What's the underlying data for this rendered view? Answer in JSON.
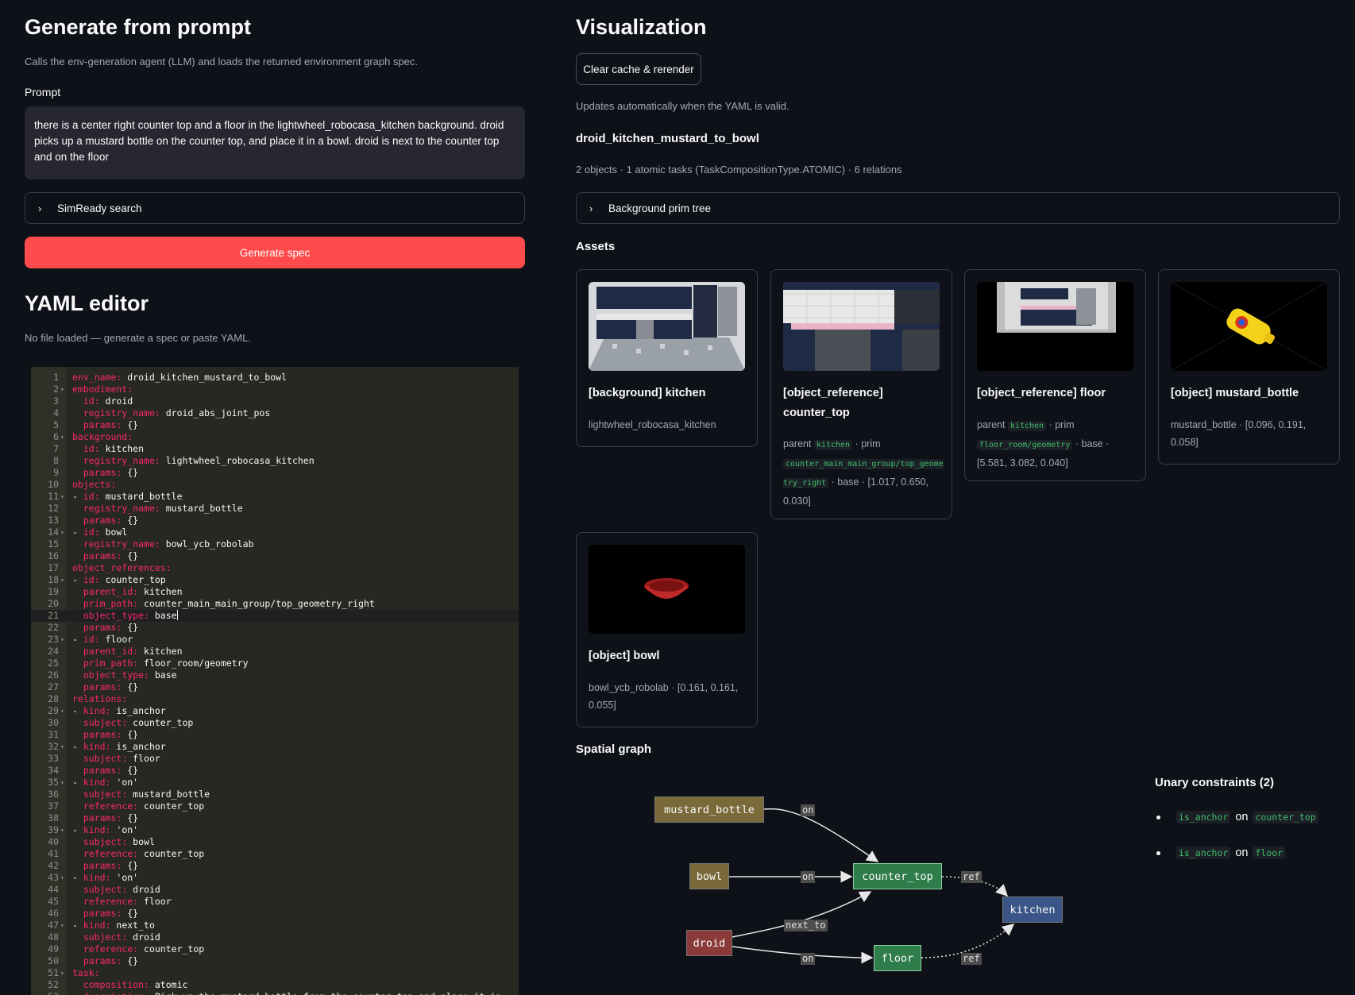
{
  "left": {
    "generate": {
      "heading": "Generate from prompt",
      "caption": "Calls the env-generation agent (LLM) and loads the returned environment graph spec.",
      "prompt_label": "Prompt",
      "prompt_value": "there is a center right counter top and a floor in the lightwheel_robocasa_kitchen background. droid picks up a mustard bottle on the counter top, and place it in a bowl. droid is next to the counter top and on the floor",
      "simready_label": "SimReady search",
      "generate_button": "Generate spec"
    },
    "yaml": {
      "heading": "YAML editor",
      "caption": "No file loaded — generate a spec or paste YAML.",
      "lines": [
        {
          "n": "1",
          "fold": "",
          "key": "env_name:",
          "val": " droid_kitchen_mustard_to_bowl",
          "indent": ""
        },
        {
          "n": "2",
          "fold": "▾",
          "key": "embodiment:",
          "val": "",
          "indent": ""
        },
        {
          "n": "3",
          "fold": "",
          "key": "id:",
          "val": " droid",
          "indent": "  "
        },
        {
          "n": "4",
          "fold": "",
          "key": "registry_name:",
          "val": " droid_abs_joint_pos",
          "indent": "  "
        },
        {
          "n": "5",
          "fold": "",
          "key": "params:",
          "val": " {}",
          "indent": "  "
        },
        {
          "n": "6",
          "fold": "▾",
          "key": "background:",
          "val": "",
          "indent": ""
        },
        {
          "n": "7",
          "fold": "",
          "key": "id:",
          "val": " kitchen",
          "indent": "  "
        },
        {
          "n": "8",
          "fold": "",
          "key": "registry_name:",
          "val": " lightwheel_robocasa_kitchen",
          "indent": "  "
        },
        {
          "n": "9",
          "fold": "",
          "key": "params:",
          "val": " {}",
          "indent": "  "
        },
        {
          "n": "10",
          "fold": "",
          "key": "objects:",
          "val": "",
          "indent": ""
        },
        {
          "n": "11",
          "fold": "▾",
          "key": "id:",
          "val": " mustard_bottle",
          "indent": "- "
        },
        {
          "n": "12",
          "fold": "",
          "key": "registry_name:",
          "val": " mustard_bottle",
          "indent": "  "
        },
        {
          "n": "13",
          "fold": "",
          "key": "params:",
          "val": " {}",
          "indent": "  "
        },
        {
          "n": "14",
          "fold": "▾",
          "key": "id:",
          "val": " bowl",
          "indent": "- "
        },
        {
          "n": "15",
          "fold": "",
          "key": "registry_name:",
          "val": " bowl_ycb_robolab",
          "indent": "  "
        },
        {
          "n": "16",
          "fold": "",
          "key": "params:",
          "val": " {}",
          "indent": "  "
        },
        {
          "n": "17",
          "fold": "",
          "key": "object_references:",
          "val": "",
          "indent": ""
        },
        {
          "n": "18",
          "fold": "▾",
          "key": "id:",
          "val": " counter_top",
          "indent": "- "
        },
        {
          "n": "19",
          "fold": "",
          "key": "parent_id:",
          "val": " kitchen",
          "indent": "  "
        },
        {
          "n": "20",
          "fold": "",
          "key": "prim_path:",
          "val": " counter_main_main_group/top_geometry_right",
          "indent": "  "
        },
        {
          "n": "21",
          "fold": "",
          "key": "object_type:",
          "val": " base",
          "indent": "  "
        },
        {
          "n": "22",
          "fold": "",
          "key": "params:",
          "val": " {}",
          "indent": "  "
        },
        {
          "n": "23",
          "fold": "▾",
          "key": "id:",
          "val": " floor",
          "indent": "- "
        },
        {
          "n": "24",
          "fold": "",
          "key": "parent_id:",
          "val": " kitchen",
          "indent": "  "
        },
        {
          "n": "25",
          "fold": "",
          "key": "prim_path:",
          "val": " floor_room/geometry",
          "indent": "  "
        },
        {
          "n": "26",
          "fold": "",
          "key": "object_type:",
          "val": " base",
          "indent": "  "
        },
        {
          "n": "27",
          "fold": "",
          "key": "params:",
          "val": " {}",
          "indent": "  "
        },
        {
          "n": "28",
          "fold": "",
          "key": "relations:",
          "val": "",
          "indent": ""
        },
        {
          "n": "29",
          "fold": "▾",
          "key": "kind:",
          "val": " is_anchor",
          "indent": "- "
        },
        {
          "n": "30",
          "fold": "",
          "key": "subject:",
          "val": " counter_top",
          "indent": "  "
        },
        {
          "n": "31",
          "fold": "",
          "key": "params:",
          "val": " {}",
          "indent": "  "
        },
        {
          "n": "32",
          "fold": "▾",
          "key": "kind:",
          "val": " is_anchor",
          "indent": "- "
        },
        {
          "n": "33",
          "fold": "",
          "key": "subject:",
          "val": " floor",
          "indent": "  "
        },
        {
          "n": "34",
          "fold": "",
          "key": "params:",
          "val": " {}",
          "indent": "  "
        },
        {
          "n": "35",
          "fold": "▾",
          "key": "kind:",
          "val": " 'on'",
          "indent": "- "
        },
        {
          "n": "36",
          "fold": "",
          "key": "subject:",
          "val": " mustard_bottle",
          "indent": "  "
        },
        {
          "n": "37",
          "fold": "",
          "key": "reference:",
          "val": " counter_top",
          "indent": "  "
        },
        {
          "n": "38",
          "fold": "",
          "key": "params:",
          "val": " {}",
          "indent": "  "
        },
        {
          "n": "39",
          "fold": "▾",
          "key": "kind:",
          "val": " 'on'",
          "indent": "- "
        },
        {
          "n": "40",
          "fold": "",
          "key": "subject:",
          "val": " bowl",
          "indent": "  "
        },
        {
          "n": "41",
          "fold": "",
          "key": "reference:",
          "val": " counter_top",
          "indent": "  "
        },
        {
          "n": "42",
          "fold": "",
          "key": "params:",
          "val": " {}",
          "indent": "  "
        },
        {
          "n": "43",
          "fold": "▾",
          "key": "kind:",
          "val": " 'on'",
          "indent": "- "
        },
        {
          "n": "44",
          "fold": "",
          "key": "subject:",
          "val": " droid",
          "indent": "  "
        },
        {
          "n": "45",
          "fold": "",
          "key": "reference:",
          "val": " floor",
          "indent": "  "
        },
        {
          "n": "46",
          "fold": "",
          "key": "params:",
          "val": " {}",
          "indent": "  "
        },
        {
          "n": "47",
          "fold": "▾",
          "key": "kind:",
          "val": " next_to",
          "indent": "- "
        },
        {
          "n": "48",
          "fold": "",
          "key": "subject:",
          "val": " droid",
          "indent": "  "
        },
        {
          "n": "49",
          "fold": "",
          "key": "reference:",
          "val": " counter_top",
          "indent": "  "
        },
        {
          "n": "50",
          "fold": "",
          "key": "params:",
          "val": " {}",
          "indent": "  "
        },
        {
          "n": "51",
          "fold": "▾",
          "key": "task:",
          "val": "",
          "indent": ""
        },
        {
          "n": "52",
          "fold": "",
          "key": "composition:",
          "val": " atomic",
          "indent": "  "
        },
        {
          "n": "53",
          "fold": "▾",
          "key": "description:",
          "val": " Pick up the mustard bottle from the counter top and place it in",
          "indent": "  "
        }
      ]
    }
  },
  "right": {
    "heading": "Visualization",
    "clear_button": "Clear cache & rerender",
    "caption": "Updates automatically when the YAML is valid.",
    "env_name": "droid_kitchen_mustard_to_bowl",
    "summary": "2 objects · 1 atomic tasks (TaskCompositionType.ATOMIC) · 6 relations",
    "prim_tree_label": "Background prim tree",
    "assets_heading": "Assets",
    "assets": [
      {
        "title": "[background] kitchen",
        "meta": "lightwheel_robocasa_kitchen"
      },
      {
        "title": "[object_reference] counter_top",
        "parent_label": "parent",
        "parent": "kitchen",
        "prim_label": "· prim",
        "prim": "counter_main_main_group/top_geometry_right",
        "base": "· base · [1.017, 0.650, 0.030]"
      },
      {
        "title": "[object_reference] floor",
        "parent_label": "parent",
        "parent": "kitchen",
        "prim_label": "· prim",
        "prim": "floor_room/geometry",
        "base": "· base · [5.581, 3.082, 0.040]"
      },
      {
        "title": "[object] mustard_bottle",
        "meta": "mustard_bottle · [0.096, 0.191, 0.058]"
      },
      {
        "title": "[object] bowl",
        "meta": "bowl_ycb_robolab · [0.161, 0.161, 0.055]"
      }
    ],
    "spatial_heading": "Spatial graph",
    "graph": {
      "nodes": {
        "mustard_bottle": "mustard_bottle",
        "bowl": "bowl",
        "droid": "droid",
        "counter_top": "counter_top",
        "floor": "floor",
        "kitchen": "kitchen"
      },
      "edge_labels": {
        "on1": "on",
        "on2": "on",
        "on3": "on",
        "next_to": "next_to",
        "ref1": "ref",
        "ref2": "ref"
      },
      "colors": {
        "object": "#7a6a3a",
        "robot": "#8b3a3a",
        "reference": "#2e7d4a",
        "background": "#3a5588"
      }
    },
    "unary": {
      "heading": "Unary constraints (2)",
      "items": [
        {
          "kind": "is_anchor",
          "on": "on",
          "target": "counter_top"
        },
        {
          "kind": "is_anchor",
          "on": "on",
          "target": "floor"
        }
      ]
    }
  }
}
